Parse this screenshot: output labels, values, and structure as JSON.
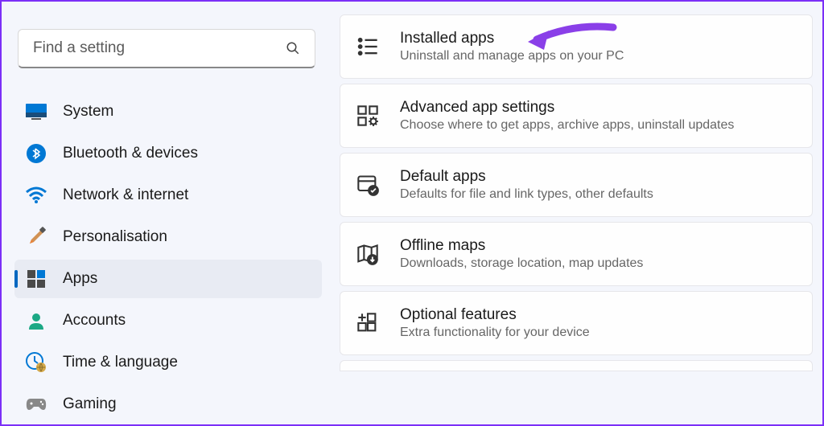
{
  "search": {
    "placeholder": "Find a setting"
  },
  "sidebar": {
    "items": [
      {
        "label": "System"
      },
      {
        "label": "Bluetooth & devices"
      },
      {
        "label": "Network & internet"
      },
      {
        "label": "Personalisation"
      },
      {
        "label": "Apps"
      },
      {
        "label": "Accounts"
      },
      {
        "label": "Time & language"
      },
      {
        "label": "Gaming"
      }
    ],
    "selected_index": 4
  },
  "main": {
    "cards": [
      {
        "title": "Installed apps",
        "subtitle": "Uninstall and manage apps on your PC"
      },
      {
        "title": "Advanced app settings",
        "subtitle": "Choose where to get apps, archive apps, uninstall updates"
      },
      {
        "title": "Default apps",
        "subtitle": "Defaults for file and link types, other defaults"
      },
      {
        "title": "Offline maps",
        "subtitle": "Downloads, storage location, map updates"
      },
      {
        "title": "Optional features",
        "subtitle": "Extra functionality for your device"
      }
    ]
  },
  "annotation": {
    "target": "Installed apps",
    "color": "#8a3fe8"
  }
}
